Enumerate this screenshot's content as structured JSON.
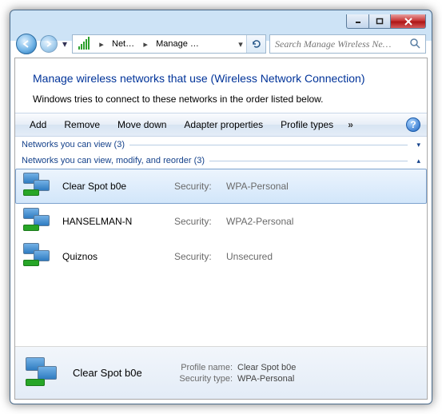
{
  "titlebar": {
    "min": "–",
    "max": "▭",
    "close": "✕"
  },
  "nav": {
    "crumbs": [
      "Net…",
      "Manage …"
    ],
    "search_placeholder": "Search Manage Wireless Ne…"
  },
  "header": {
    "title": "Manage wireless networks that use (Wireless Network Connection)",
    "subtitle": "Windows tries to connect to these networks in the order listed below."
  },
  "toolbar": {
    "add": "Add",
    "remove": "Remove",
    "movedown": "Move down",
    "adapter": "Adapter properties",
    "profile": "Profile types",
    "more": "»",
    "help": "?"
  },
  "groups": {
    "view": {
      "label": "Networks you can view (3)",
      "caret": "▾"
    },
    "modify": {
      "label": "Networks you can view, modify, and reorder (3)",
      "caret": "▴"
    }
  },
  "security_label": "Security:",
  "networks": [
    {
      "name": "Clear Spot b0e",
      "security": "WPA-Personal",
      "selected": true
    },
    {
      "name": "HANSELMAN-N",
      "security": "WPA2-Personal",
      "selected": false
    },
    {
      "name": "Quiznos",
      "security": "Unsecured",
      "selected": false
    }
  ],
  "details": {
    "name": "Clear Spot b0e",
    "profile_name_label": "Profile name:",
    "profile_name": "Clear Spot b0e",
    "security_type_label": "Security type:",
    "security_type": "WPA-Personal"
  }
}
